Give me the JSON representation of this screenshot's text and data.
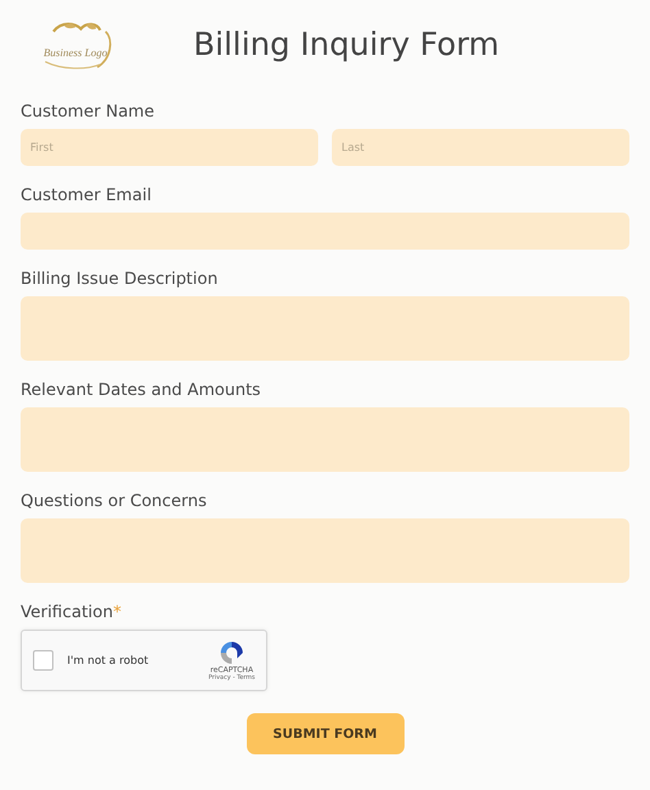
{
  "logo": {
    "text": "Business Logo"
  },
  "title": "Billing Inquiry Form",
  "fields": [
    {
      "kind": "name",
      "label": "Customer Name",
      "parts": [
        {
          "placeholder": "First"
        },
        {
          "placeholder": "Last"
        }
      ]
    },
    {
      "kind": "text",
      "label": "Customer Email"
    },
    {
      "kind": "textarea",
      "label": "Billing Issue Description"
    },
    {
      "kind": "textarea",
      "label": "Relevant Dates and Amounts"
    },
    {
      "kind": "textarea",
      "label": "Questions or Concerns"
    },
    {
      "kind": "captcha",
      "label": "Verification",
      "required_mark": "*",
      "captcha": {
        "checked": false,
        "text": "I'm not a robot",
        "brand": "reCAPTCHA",
        "links": "Privacy - Terms"
      }
    }
  ],
  "submit": "SUBMIT FORM"
}
